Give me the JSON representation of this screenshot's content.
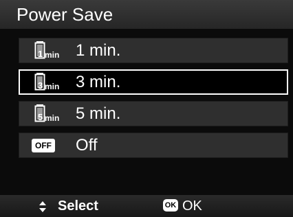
{
  "header": {
    "title": "Power Save"
  },
  "menu": {
    "items": [
      {
        "label": "1 min.",
        "icon": "battery-timer-icon",
        "icon_text": "1",
        "icon_unit": "min",
        "selected": false
      },
      {
        "label": "3 min.",
        "icon": "battery-timer-icon",
        "icon_text": "3",
        "icon_unit": "min",
        "selected": true
      },
      {
        "label": "5 min.",
        "icon": "battery-timer-icon",
        "icon_text": "5",
        "icon_unit": "min",
        "selected": false
      },
      {
        "label": "Off",
        "icon": "off-badge-icon",
        "icon_text": "OFF",
        "selected": false
      }
    ]
  },
  "footer": {
    "select_label": "Select",
    "ok_badge": "OK",
    "ok_label": "OK",
    "nav_icon": "up-down-arrows-icon"
  },
  "colors": {
    "background": "#0b0b0b",
    "item_background": "#2f2f2f",
    "selected_border": "#ffffff",
    "text": "#ffffff"
  }
}
